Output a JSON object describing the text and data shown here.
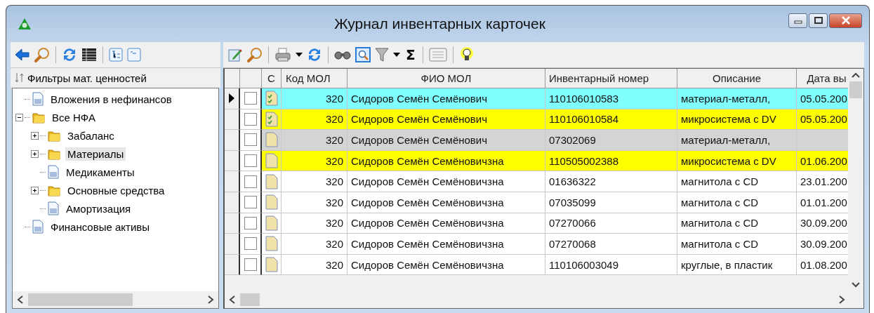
{
  "window": {
    "title": "Журнал инвентарных карточек"
  },
  "left_toolbar": [
    {
      "kind": "back"
    },
    {
      "kind": "search"
    },
    {
      "kind": "sep"
    },
    {
      "kind": "refresh"
    },
    {
      "kind": "grid"
    },
    {
      "kind": "sep"
    },
    {
      "kind": "tree"
    },
    {
      "kind": "panel"
    }
  ],
  "right_toolbar": [
    {
      "kind": "edit"
    },
    {
      "kind": "search"
    },
    {
      "kind": "sep"
    },
    {
      "kind": "printer"
    },
    {
      "kind": "caret"
    },
    {
      "kind": "refresh"
    },
    {
      "kind": "sep"
    },
    {
      "kind": "binoculars"
    },
    {
      "kind": "preview"
    },
    {
      "kind": "filter"
    },
    {
      "kind": "caret"
    },
    {
      "kind": "text",
      "text": "Σ"
    },
    {
      "kind": "sep"
    },
    {
      "kind": "list"
    },
    {
      "kind": "sep"
    },
    {
      "kind": "bulb"
    }
  ],
  "filters": {
    "title": "Фильтры мат. ценностей",
    "tree": [
      {
        "label": "Вложения в нефинансов",
        "kind": "doc",
        "selected": false
      },
      {
        "label": "Все НФА",
        "kind": "folder",
        "expanded": true,
        "selected": false,
        "children": [
          {
            "label": "Забаланс",
            "kind": "folder",
            "expanded": false,
            "selected": false
          },
          {
            "label": "Материалы",
            "kind": "folder",
            "expanded": false,
            "selected": true
          },
          {
            "label": "Медикаменты",
            "kind": "doc",
            "selected": false
          },
          {
            "label": "Основные средства",
            "kind": "folder",
            "expanded": false,
            "selected": false
          },
          {
            "label": "Амортизация",
            "kind": "doc",
            "selected": false
          }
        ]
      },
      {
        "label": "Финансовые активы",
        "kind": "doc",
        "selected": false
      }
    ]
  },
  "table": {
    "columns": [
      "С",
      "Код МОЛ",
      "ФИО МОЛ",
      "Инвентарный номер",
      "Описание",
      "Дата вы"
    ],
    "rows": [
      {
        "current": true,
        "checked": false,
        "signed": true,
        "color": "#80ffff",
        "code": "320",
        "name": "Сидоров Семён Семёнович",
        "inv": "110106010583",
        "desc": "материал-металл,",
        "date": "05.05.200"
      },
      {
        "current": false,
        "checked": false,
        "signed": true,
        "color": "#ffff00",
        "code": "320",
        "name": "Сидоров Семён Семёнович",
        "inv": "110106010584",
        "desc": "микросистема с DV",
        "date": "05.05.200"
      },
      {
        "current": false,
        "checked": false,
        "signed": false,
        "color": "#d4d4d4",
        "code": "320",
        "name": "Сидоров Семён Семёнович",
        "inv": "07302069",
        "desc": "материал-металл,"
      },
      {
        "current": false,
        "checked": false,
        "signed": false,
        "color": "#ffff00",
        "code": "320",
        "name": "Сидоров Семён Семёновичзна",
        "inv": "110505002388",
        "desc": "микросистема с DV",
        "date": "01.06.200"
      },
      {
        "current": false,
        "checked": false,
        "signed": false,
        "color": "#ffffff",
        "code": "320",
        "name": "Сидоров Семён Семёновичзна",
        "inv": "01636322",
        "desc": "магнитола с CD",
        "date": "23.01.200"
      },
      {
        "current": false,
        "checked": false,
        "signed": false,
        "color": "#ffffff",
        "code": "320",
        "name": "Сидоров Семён Семёновичзна",
        "inv": "07035099",
        "desc": "магнитола с CD",
        "date": "01.01.200"
      },
      {
        "current": false,
        "checked": false,
        "signed": false,
        "color": "#ffffff",
        "code": "320",
        "name": "Сидоров Семён Семёновичзна",
        "inv": "07270066",
        "desc": "магнитола с CD",
        "date": "30.09.200"
      },
      {
        "current": false,
        "checked": false,
        "signed": false,
        "color": "#ffffff",
        "code": "320",
        "name": "Сидоров Семён Семёновичзна",
        "inv": "07270068",
        "desc": "магнитола с CD",
        "date": "30.09.200"
      },
      {
        "current": false,
        "checked": false,
        "signed": false,
        "color": "#ffffff",
        "code": "320",
        "name": "Сидоров Семён Семёновичзна",
        "inv": "110106003049",
        "desc": "круглые, в  пластик",
        "date": "01.08.200"
      }
    ]
  }
}
